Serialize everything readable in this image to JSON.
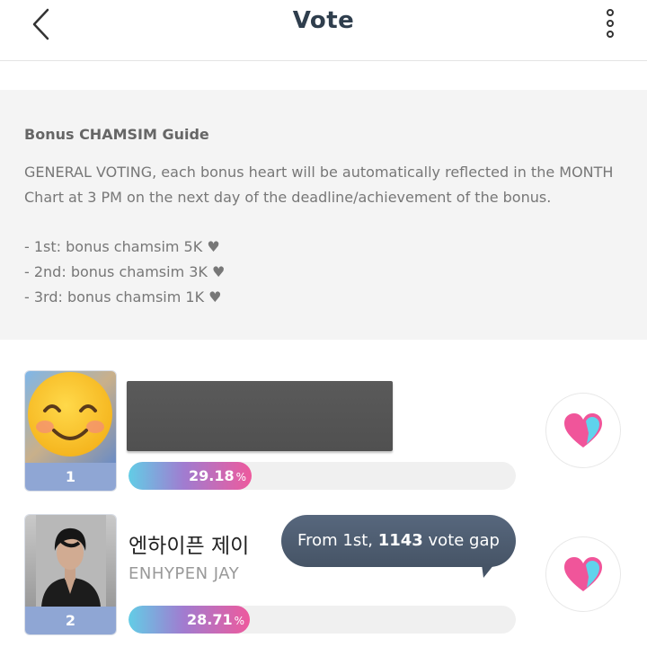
{
  "header": {
    "title": "Vote",
    "back_icon": "chevron-left-icon",
    "more_icon": "more-vertical-icon"
  },
  "guide": {
    "title": "Bonus CHAMSIM Guide",
    "body": "GENERAL VOTING, each bonus heart will be automatically reflected in the MONTH Chart at 3 PM on the next day of the deadline/achievement of the bonus.",
    "items": [
      "- 1st: bonus chamsim 5K ♥",
      "- 2nd: bonus chamsim 3K ♥",
      "- 3rd: bonus chamsim 1K ♥"
    ]
  },
  "rankings": [
    {
      "rank": "1",
      "name_redacted": true,
      "percent_value": "29.18",
      "percent_sign": "%",
      "share": 0.2918,
      "vote_icon": "heart-icon"
    },
    {
      "rank": "2",
      "name_ko": "엔하이픈 제이",
      "name_en": "ENHYPEN JAY",
      "percent_value": "28.71",
      "percent_sign": "%",
      "share": 0.2871,
      "vote_icon": "heart-icon"
    }
  ],
  "tooltip": {
    "prefix": "From 1st, ",
    "gap": "1143",
    "suffix": " vote gap"
  },
  "colors": {
    "rank_badge": "#8fa6d4",
    "progress_start": "#62cde6",
    "progress_end": "#ee5a9d",
    "heart_pink": "#f0559a",
    "heart_cyan": "#5fd3ec",
    "tooltip_bg": "#4f5e72"
  }
}
